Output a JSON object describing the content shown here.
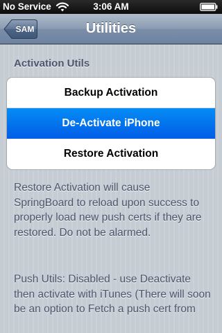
{
  "status_bar": {
    "carrier": "No Service",
    "time": "3:06 AM",
    "wifi_icon": "wifi-icon",
    "battery_icon": "battery-icon"
  },
  "nav_bar": {
    "back_label": "SAM",
    "title": "Utilities"
  },
  "sections": [
    {
      "header": "Activation Utils",
      "cells": [
        {
          "label": "Backup Activation",
          "selected": false
        },
        {
          "label": "De-Activate iPhone",
          "selected": true
        },
        {
          "label": "Restore Activation",
          "selected": false
        }
      ],
      "footer": "Restore Activation will cause SpringBoard to reload upon success to properly load new push certs if they are restored.  Do not be alarmed."
    },
    {
      "footer": "Push Utils: Disabled - use Deactivate then activate with iTunes (There will soon be an option to Fetch a push cert from"
    }
  ],
  "colors": {
    "selection_blue": "#015ee6",
    "nav_bar_blue": "#6d83a0",
    "background": "#c5ccd4",
    "section_text": "#4c566c"
  }
}
